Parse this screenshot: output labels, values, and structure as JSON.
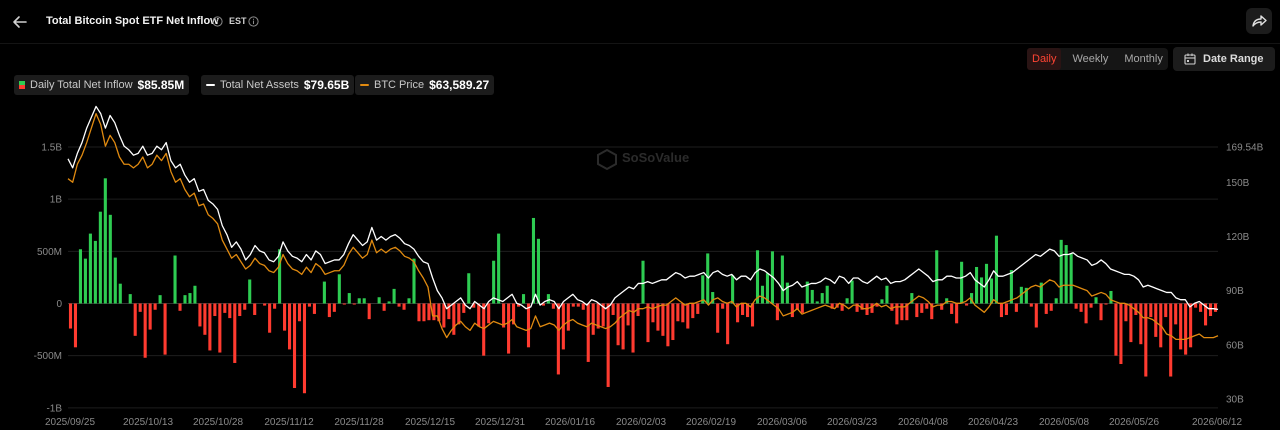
{
  "header": {
    "title": "Total Bitcoin Spot ETF Net Inflow",
    "timezone": "EST"
  },
  "periods": [
    "Daily",
    "Weekly",
    "Monthly"
  ],
  "active_period": "Daily",
  "date_range_label": "Date Range",
  "legend": [
    {
      "name": "Daily Total Net Inflow",
      "value": "$85.85M"
    },
    {
      "name": "Total Net Assets",
      "value": "$79.65B"
    },
    {
      "name": "BTC Price",
      "value": "$63,589.27"
    }
  ],
  "watermark": "SoSoValue",
  "colors": {
    "positive": "#2ecc52",
    "negative": "#ff3b30",
    "net_assets": "#ffffff",
    "btc_price": "#e08a10",
    "active_period": "#ff4433"
  },
  "chart_data": {
    "type": "bar",
    "title": "Total Bitcoin Spot ETF Net Inflow",
    "x_tick_labels": [
      "2025/09/25",
      "2025/10/13",
      "2025/10/28",
      "2025/11/12",
      "2025/11/28",
      "2025/12/15",
      "2025/12/31",
      "2026/01/16",
      "2026/02/03",
      "2026/02/19",
      "2026/03/06",
      "2026/03/23",
      "2026/04/08",
      "2026/04/23",
      "2026/05/08",
      "2026/05/26",
      "2026/06/12"
    ],
    "y_left_ticks": [
      "1.5B",
      "1B",
      "500M",
      "0",
      "-500M",
      "-1B"
    ],
    "y_left_range": [
      -1000,
      1500
    ],
    "y_left_unit": "M USD",
    "y_right_ticks": [
      "169.54B",
      "150B",
      "120B",
      "90B",
      "60B",
      "30B"
    ],
    "y_right_range": [
      30,
      169.54
    ],
    "y_right_unit": "B USD",
    "grid": true,
    "legend_position": "top-left",
    "series": [
      {
        "name": "Daily Total Net Inflow",
        "type": "bar",
        "values": [
          -240,
          -420,
          520,
          430,
          670,
          600,
          880,
          1200,
          850,
          440,
          190,
          0,
          90,
          -310,
          -80,
          -520,
          -250,
          -60,
          80,
          -490,
          0,
          460,
          -70,
          80,
          100,
          170,
          -220,
          -300,
          -450,
          -120,
          -470,
          -90,
          -140,
          -570,
          -120,
          -60,
          230,
          -110,
          0,
          -20,
          -280,
          -50,
          520,
          -260,
          -440,
          -810,
          -170,
          -860,
          -30,
          -100,
          0,
          210,
          -130,
          -80,
          280,
          -10,
          100,
          -10,
          50,
          50,
          -150,
          0,
          60,
          -70,
          20,
          140,
          -30,
          -60,
          50,
          430,
          -170,
          -170,
          -160,
          -160,
          -170,
          -230,
          -150,
          -300,
          -200,
          -90,
          290,
          -40,
          -220,
          -500,
          -190,
          410,
          670,
          -230,
          -480,
          -200,
          -30,
          90,
          -420,
          820,
          620,
          -20,
          90,
          -50,
          -680,
          -440,
          -260,
          -30,
          -30,
          -60,
          -560,
          -300,
          -240,
          -220,
          -800,
          -110,
          -400,
          -440,
          -210,
          -470,
          -120,
          410,
          -370,
          -180,
          -260,
          -310,
          -410,
          -350,
          -170,
          -180,
          -240,
          -140,
          -100,
          270,
          480,
          110,
          -280,
          -50,
          -390,
          270,
          -180,
          -110,
          -130,
          -220,
          510,
          170,
          290,
          500,
          -160,
          460,
          200,
          -130,
          -60,
          -90,
          210,
          130,
          20,
          100,
          170,
          -50,
          -40,
          -70,
          50,
          220,
          -80,
          -60,
          -110,
          -90,
          -30,
          40,
          170,
          -70,
          -200,
          -160,
          -160,
          100,
          -130,
          -90,
          -50,
          -150,
          510,
          -60,
          50,
          -100,
          -190,
          400,
          -20,
          100,
          350,
          250,
          380,
          240,
          650,
          -130,
          -110,
          320,
          -80,
          160,
          150,
          -30,
          -230,
          200,
          -100,
          -70,
          50,
          610,
          560,
          480,
          -50,
          -80,
          -190,
          -40,
          60,
          -160,
          -10,
          120,
          -500,
          -580,
          -170,
          -370,
          -110,
          -390,
          -700,
          -130,
          -320,
          -420,
          -130,
          -700,
          -200,
          -440,
          -490,
          -420,
          -40,
          -80,
          -210,
          -120,
          -80
        ]
      },
      {
        "name": "Total Net Assets",
        "type": "line",
        "unit": "B USD",
        "values": [
          163,
          158,
          166,
          172,
          180,
          186,
          192,
          188,
          180,
          187,
          183,
          176,
          170,
          168,
          165,
          166,
          170,
          165,
          166,
          170,
          168,
          172,
          162,
          158,
          160,
          154,
          150,
          152,
          145,
          146,
          140,
          138,
          135,
          126,
          121,
          114,
          117,
          113,
          107,
          110,
          115,
          112,
          111,
          107,
          106,
          109,
          117,
          112,
          109,
          108,
          106,
          110,
          107,
          112,
          110,
          105,
          106,
          107,
          107,
          110,
          116,
          121,
          118,
          115,
          117,
          125,
          118,
          120,
          118,
          120,
          121,
          119,
          116,
          115,
          113,
          109,
          106,
          105,
          97,
          90,
          86,
          80,
          82,
          84,
          86,
          82,
          80,
          84,
          82,
          80,
          84,
          86,
          85,
          84,
          86,
          88,
          83,
          82,
          80,
          81,
          88,
          82,
          84,
          85,
          84,
          80,
          84,
          86,
          88,
          85,
          84,
          82,
          85,
          84,
          82,
          80,
          82,
          86,
          88,
          90,
          92,
          91,
          94,
          94,
          95,
          94,
          95,
          96,
          96,
          98,
          100,
          99,
          97,
          98,
          98,
          99,
          100,
          97,
          100,
          101,
          99,
          98,
          99,
          96,
          98,
          98,
          96,
          100,
          102,
          101,
          99,
          97,
          94,
          90,
          92,
          93,
          95,
          92,
          93,
          94,
          94,
          95,
          97,
          96,
          94,
          98,
          97,
          94,
          97,
          97,
          95,
          94,
          96,
          98,
          96,
          97,
          94,
          95,
          95,
          96,
          98,
          100,
          102,
          100,
          98,
          95,
          96,
          96,
          98,
          98,
          97,
          97,
          98,
          100,
          96,
          94,
          92,
          96,
          101,
          98,
          98,
          99,
          100,
          102,
          104,
          106,
          108,
          110,
          109,
          111,
          113,
          112,
          109,
          110,
          110,
          111,
          109,
          108,
          107,
          104,
          105,
          107,
          105,
          102,
          101,
          100,
          99,
          99,
          98,
          96,
          92,
          93,
          92,
          91,
          90,
          89,
          89,
          86,
          85,
          85,
          81,
          83,
          84,
          82,
          80,
          80,
          79.65
        ]
      },
      {
        "name": "BTC Price",
        "type": "line",
        "unit": "USD (right-axis scaled)",
        "values": [
          152,
          150,
          160,
          165,
          172,
          180,
          188,
          182,
          170,
          176,
          172,
          164,
          160,
          160,
          158,
          160,
          164,
          158,
          160,
          165,
          162,
          166,
          156,
          150,
          152,
          146,
          142,
          144,
          137,
          138,
          132,
          130,
          127,
          118,
          113,
          108,
          110,
          106,
          102,
          104,
          108,
          105,
          104,
          101,
          100,
          103,
          110,
          105,
          102,
          101,
          99,
          103,
          100,
          105,
          103,
          99,
          100,
          101,
          101,
          104,
          110,
          114,
          111,
          108,
          110,
          118,
          111,
          113,
          111,
          113,
          114,
          112,
          109,
          108,
          106,
          101,
          97,
          92,
          76,
          76,
          69,
          64,
          68,
          71,
          73,
          70,
          68,
          72,
          70,
          69,
          71,
          73,
          72,
          71,
          72,
          74,
          70,
          69,
          68,
          69,
          76,
          70,
          71,
          72,
          71,
          68,
          71,
          73,
          74,
          72,
          71,
          70,
          72,
          71,
          70,
          69,
          70,
          72,
          75,
          77,
          79,
          78,
          80,
          80,
          81,
          80,
          81,
          82,
          82,
          84,
          86,
          84,
          82,
          83,
          83,
          84,
          85,
          82,
          85,
          86,
          84,
          83,
          84,
          81,
          83,
          83,
          81,
          85,
          87,
          86,
          84,
          82,
          80,
          76,
          77,
          78,
          80,
          77,
          78,
          79,
          80,
          81,
          82,
          81,
          80,
          83,
          82,
          80,
          82,
          82,
          80,
          80,
          81,
          83,
          81,
          82,
          80,
          81,
          81,
          81,
          83,
          85,
          87,
          86,
          84,
          81,
          82,
          82,
          84,
          84,
          83,
          83,
          84,
          86,
          82,
          80,
          78,
          81,
          85,
          83,
          83,
          84,
          85,
          86,
          88,
          90,
          92,
          93,
          92,
          94,
          96,
          95,
          92,
          93,
          93,
          93,
          92,
          91,
          90,
          87,
          88,
          89,
          88,
          85,
          84,
          83,
          83,
          82,
          80,
          78,
          75,
          75,
          74,
          72,
          70,
          66,
          65,
          63,
          63,
          63,
          64,
          65,
          66,
          64,
          64,
          64,
          65
        ]
      }
    ]
  }
}
